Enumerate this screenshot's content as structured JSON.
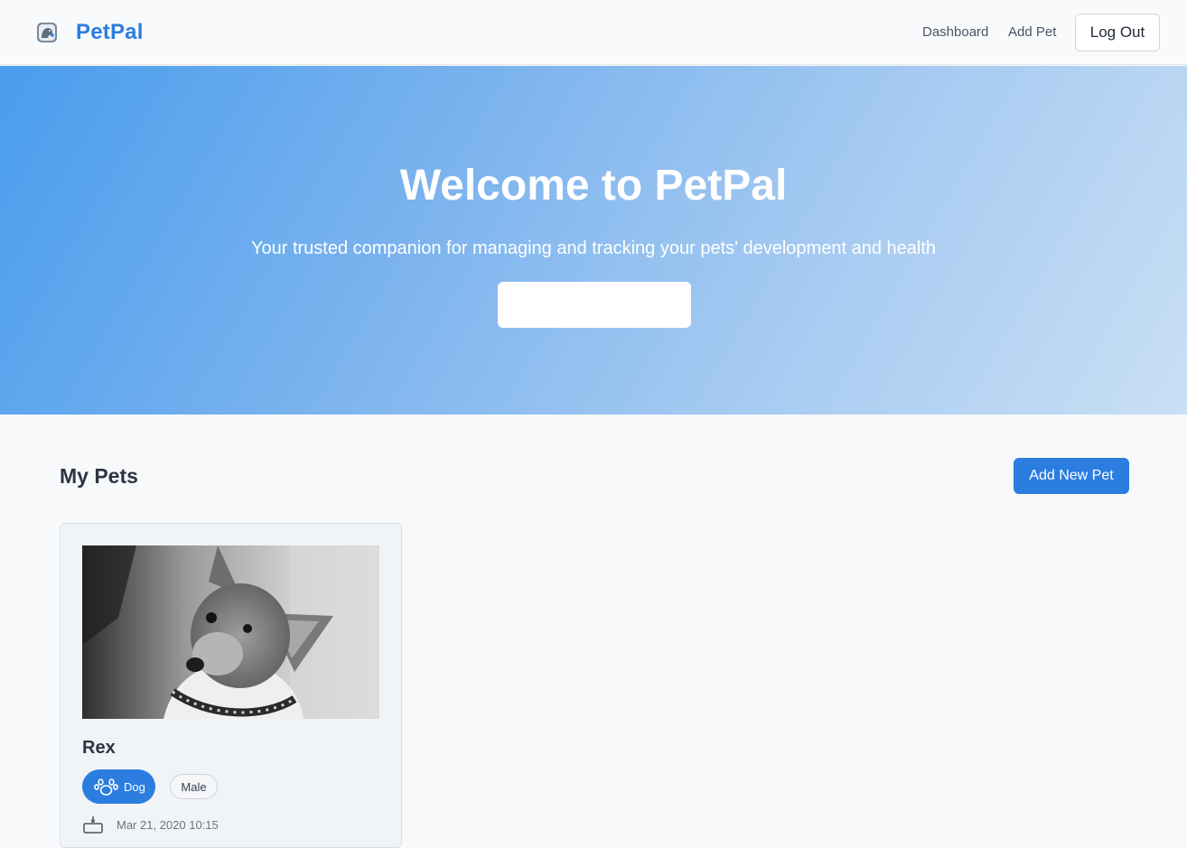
{
  "header": {
    "brand": "PetPal",
    "logo_icon": "pet-care-logo-icon",
    "nav": [
      {
        "label": "Dashboard"
      },
      {
        "label": "Add Pet"
      }
    ],
    "logout_label": "Log Out"
  },
  "hero": {
    "title": "Welcome to PetPal",
    "subtitle": "Your trusted companion for managing and tracking your pets' development and health",
    "cta_label": ""
  },
  "pets_section": {
    "title": "My Pets",
    "add_button_label": "Add New Pet",
    "pets": [
      {
        "name": "Rex",
        "species": "Dog",
        "species_icon": "paw-icon",
        "gender": "Male",
        "birth_date": "Mar 21, 2020 10:15",
        "birth_icon": "cake-icon"
      }
    ]
  },
  "colors": {
    "accent": "#2b7de0",
    "hero_gradient_start": "#4a9ded",
    "hero_gradient_end": "#c9dff5",
    "page_background": "#f7f9fb"
  }
}
